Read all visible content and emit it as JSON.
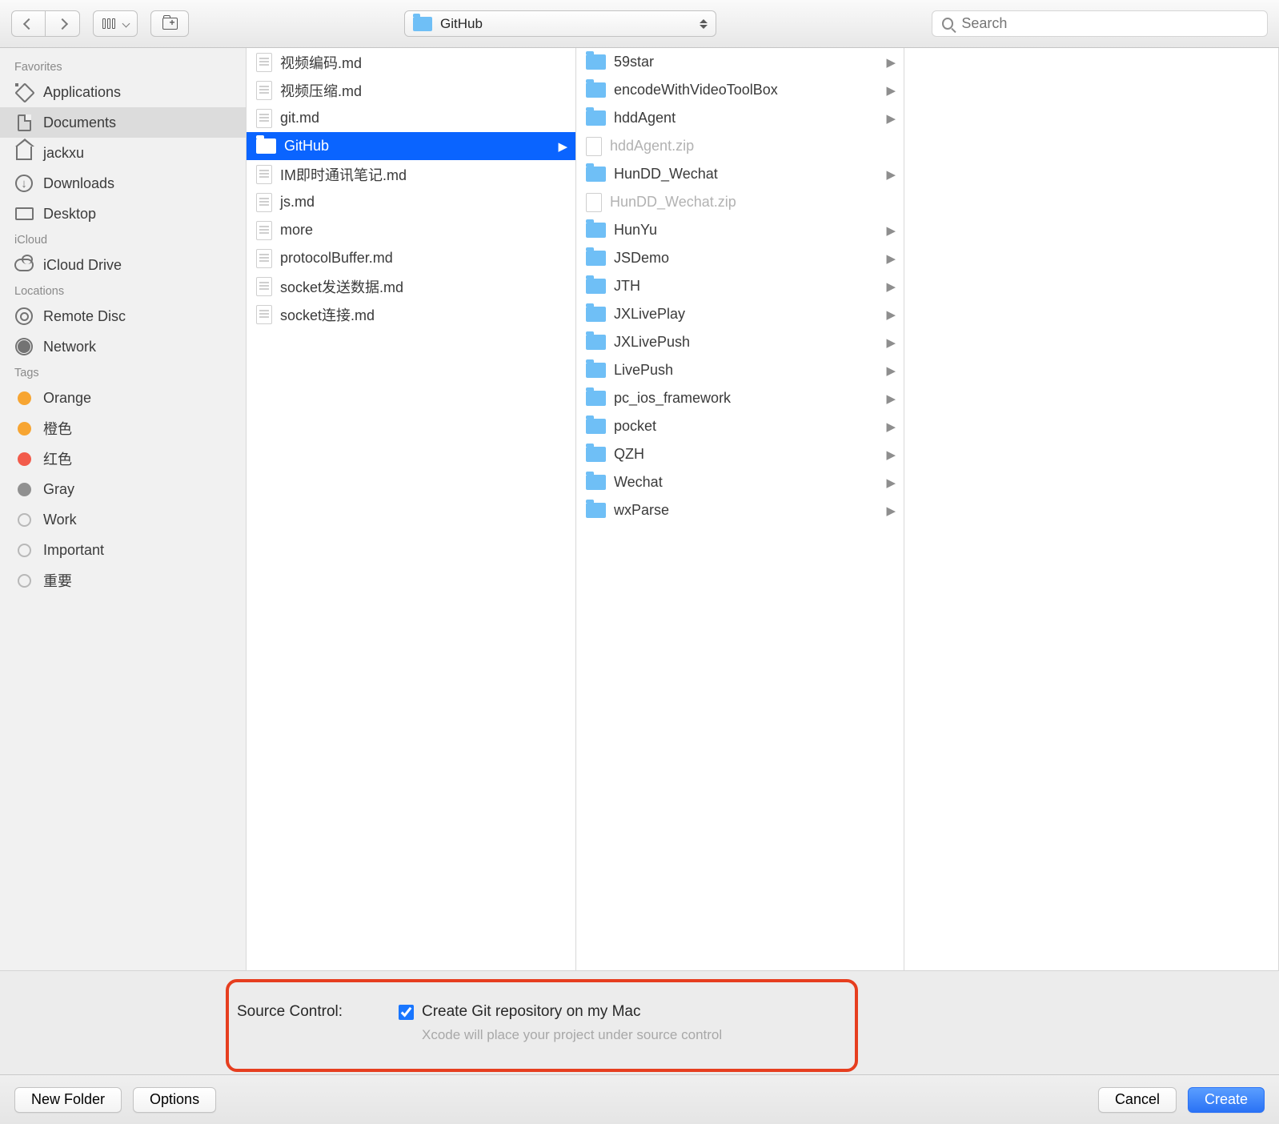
{
  "toolbar": {
    "path_label": "GitHub",
    "search_placeholder": "Search"
  },
  "sidebar": {
    "sections": [
      {
        "header": "Favorites",
        "items": [
          {
            "icon": "app",
            "label": "Applications"
          },
          {
            "icon": "doc",
            "label": "Documents",
            "selected": true
          },
          {
            "icon": "home",
            "label": "jackxu"
          },
          {
            "icon": "dl",
            "label": "Downloads"
          },
          {
            "icon": "desk",
            "label": "Desktop"
          }
        ]
      },
      {
        "header": "iCloud",
        "items": [
          {
            "icon": "cloud",
            "label": "iCloud Drive"
          }
        ]
      },
      {
        "header": "Locations",
        "items": [
          {
            "icon": "disc",
            "label": "Remote Disc"
          },
          {
            "icon": "net",
            "label": "Network"
          }
        ]
      },
      {
        "header": "Tags",
        "items": [
          {
            "icon": "tag",
            "color": "orange",
            "label": "Orange"
          },
          {
            "icon": "tag",
            "color": "orange",
            "label": "橙色"
          },
          {
            "icon": "tag",
            "color": "red",
            "label": "红色"
          },
          {
            "icon": "tag",
            "color": "gray",
            "label": "Gray"
          },
          {
            "icon": "tag",
            "color": "empty",
            "label": "Work"
          },
          {
            "icon": "tag",
            "color": "empty",
            "label": "Important"
          },
          {
            "icon": "tag",
            "color": "empty",
            "label": "重要"
          }
        ]
      }
    ]
  },
  "column1": [
    {
      "type": "file",
      "label": "视频编码.md"
    },
    {
      "type": "file",
      "label": "视频压缩.md"
    },
    {
      "type": "file",
      "label": "git.md"
    },
    {
      "type": "folder",
      "label": "GitHub",
      "selected": true,
      "arrow": true
    },
    {
      "type": "file",
      "label": "IM即时通讯笔记.md"
    },
    {
      "type": "file",
      "label": "js.md"
    },
    {
      "type": "file",
      "label": "more"
    },
    {
      "type": "file",
      "label": "protocolBuffer.md"
    },
    {
      "type": "file",
      "label": "socket发送数据.md"
    },
    {
      "type": "file",
      "label": "socket连接.md"
    }
  ],
  "column2": [
    {
      "type": "folder",
      "label": "59star",
      "arrow": true
    },
    {
      "type": "folder",
      "label": "encodeWithVideoToolBox",
      "arrow": true
    },
    {
      "type": "folder",
      "label": "hddAgent",
      "arrow": true
    },
    {
      "type": "zip",
      "label": "hddAgent.zip",
      "dim": true
    },
    {
      "type": "folder",
      "label": "HunDD_Wechat",
      "arrow": true
    },
    {
      "type": "zip",
      "label": "HunDD_Wechat.zip",
      "dim": true
    },
    {
      "type": "folder",
      "label": "HunYu",
      "arrow": true
    },
    {
      "type": "folder",
      "label": "JSDemo",
      "arrow": true
    },
    {
      "type": "folder",
      "label": "JTH",
      "arrow": true
    },
    {
      "type": "folder",
      "label": "JXLivePlay",
      "arrow": true
    },
    {
      "type": "folder",
      "label": "JXLivePush",
      "arrow": true
    },
    {
      "type": "folder",
      "label": "LivePush",
      "arrow": true
    },
    {
      "type": "folder",
      "label": "pc_ios_framework",
      "arrow": true
    },
    {
      "type": "folder",
      "label": "pocket",
      "arrow": true
    },
    {
      "type": "folder",
      "label": "QZH",
      "arrow": true
    },
    {
      "type": "folder",
      "label": "Wechat",
      "arrow": true
    },
    {
      "type": "folder",
      "label": "wxParse",
      "arrow": true
    }
  ],
  "source_control": {
    "label": "Source Control:",
    "checkbox_label": "Create Git repository on my Mac",
    "hint": "Xcode will place your project under source control"
  },
  "footer": {
    "new_folder": "New Folder",
    "options": "Options",
    "cancel": "Cancel",
    "create": "Create"
  }
}
